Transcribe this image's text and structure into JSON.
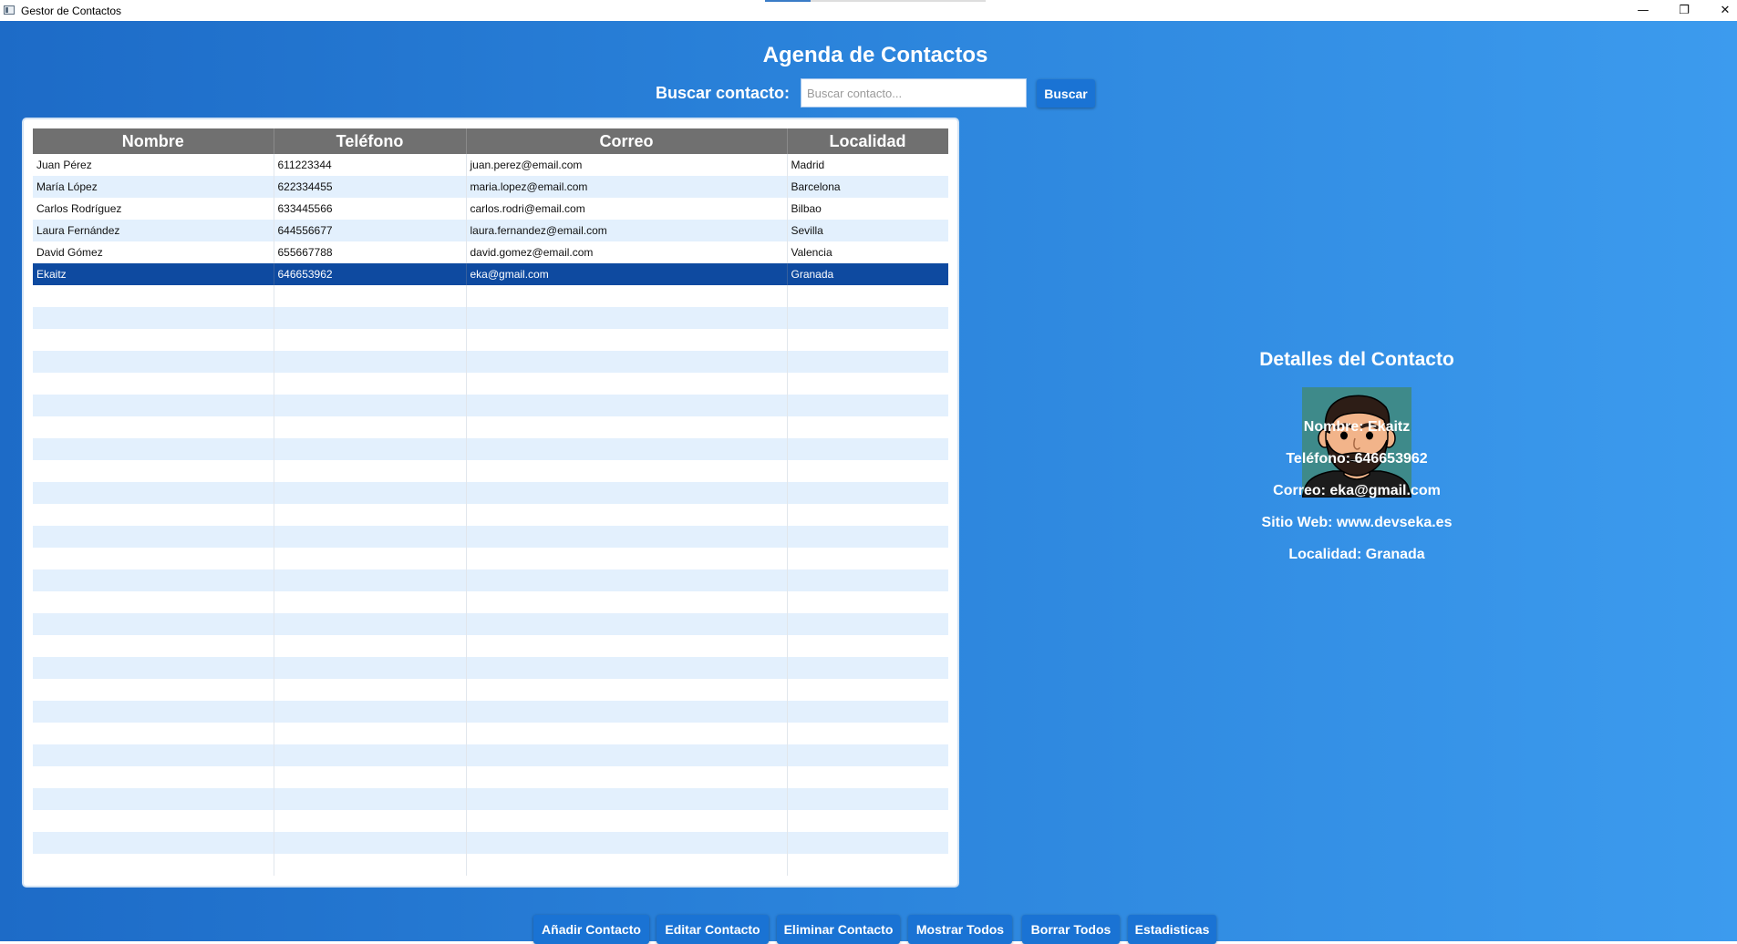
{
  "window": {
    "title": "Gestor de Contactos",
    "minimize_glyph": "—",
    "maximize_glyph": "❐",
    "close_glyph": "✕"
  },
  "header": {
    "title": "Agenda de Contactos",
    "search_label": "Buscar contacto:",
    "search_placeholder": "Buscar contacto...",
    "search_value": "",
    "search_button": "Buscar"
  },
  "table": {
    "columns": [
      "Nombre",
      "Teléfono",
      "Correo",
      "Localidad"
    ],
    "rows": [
      [
        "Juan Pérez",
        "611223344",
        "juan.perez@email.com",
        "Madrid"
      ],
      [
        "María López",
        "622334455",
        "maria.lopez@email.com",
        "Barcelona"
      ],
      [
        "Carlos Rodríguez",
        "633445566",
        "carlos.rodri@email.com",
        "Bilbao"
      ],
      [
        "Laura Fernández",
        "644556677",
        "laura.fernandez@email.com",
        "Sevilla"
      ],
      [
        "David Gómez",
        "655667788",
        "david.gomez@email.com",
        "Valencia"
      ],
      [
        "Ekaitz",
        "646653962",
        "eka@gmail.com",
        "Granada"
      ]
    ],
    "selected_row": 5
  },
  "details": {
    "title": "Detalles del Contacto",
    "nombre": "Nombre: Ekaitz",
    "telefono": "Teléfono: 646653962",
    "correo": "Correo: eka@gmail.com",
    "sitio_web": "Sitio Web: www.devseka.es",
    "localidad": "Localidad: Granada"
  },
  "buttons": {
    "add": "Añadir Contacto",
    "edit": "Editar Contacto",
    "delete": "Eliminar Contacto",
    "show_all": "Mostrar Todos",
    "delete_all": "Borrar Todos",
    "stats": "Estadisticas"
  },
  "colors": {
    "background_left": "#1d6bc7",
    "background_right": "#3c9bee",
    "header_row": "#707070",
    "selected_row": "#0e4aa0",
    "alt_row": "#e3f0fd",
    "button": "#1a73d4",
    "avatar_bg": "#3e8a8a"
  },
  "icons": {
    "app": "window-app-icon",
    "avatar": "bearded-man-avatar"
  }
}
